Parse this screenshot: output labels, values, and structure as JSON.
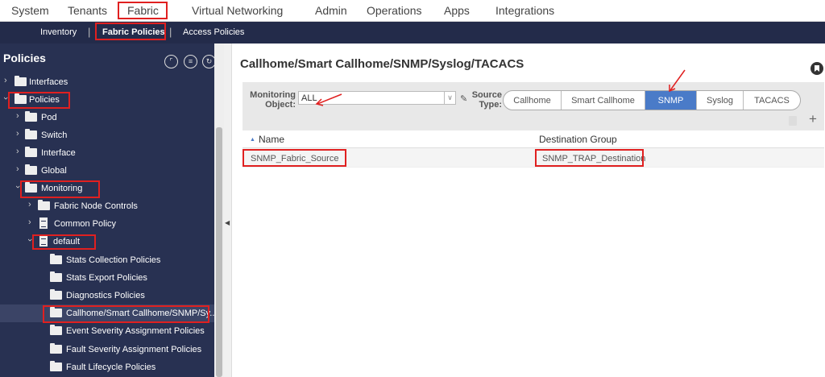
{
  "topnav": {
    "items": [
      "System",
      "Tenants",
      "Fabric",
      "Virtual Networking",
      "Admin",
      "Operations",
      "Apps",
      "Integrations"
    ]
  },
  "subnav": {
    "items": [
      "Inventory",
      "Fabric Policies",
      "Access Policies"
    ],
    "separator": "|"
  },
  "sidebar": {
    "title": "Policies",
    "tree": [
      "Interfaces",
      "Policies",
      "Pod",
      "Switch",
      "Interface",
      "Global",
      "Monitoring",
      "Fabric Node Controls",
      "Common Policy",
      "default",
      "Stats Collection Policies",
      "Stats Export Policies",
      "Diagnostics Policies",
      "Callhome/Smart Callhome/SNMP/Sy...",
      "Event Severity Assignment Policies",
      "Fault Severity Assignment Policies",
      "Fault Lifecycle Policies"
    ]
  },
  "main": {
    "title": "Callhome/Smart Callhome/SNMP/Syslog/TACACS",
    "monitoring_object_label": "Monitoring Object:",
    "monitoring_object_value": "ALL",
    "source_type_label": "Source Type:",
    "source_types": [
      "Callhome",
      "Smart Callhome",
      "SNMP",
      "Syslog",
      "TACACS"
    ],
    "source_type_selected": "SNMP",
    "columns": [
      "Name",
      "Destination Group"
    ],
    "rows": [
      {
        "name": "SNMP_Fabric_Source",
        "destination_group": "SNMP_TRAP_Destination"
      }
    ]
  },
  "colors": {
    "highlight": "#e02020",
    "sidebar_bg": "#283152",
    "subnav_bg": "#232b4a",
    "active_segment": "#4a7bc8"
  }
}
